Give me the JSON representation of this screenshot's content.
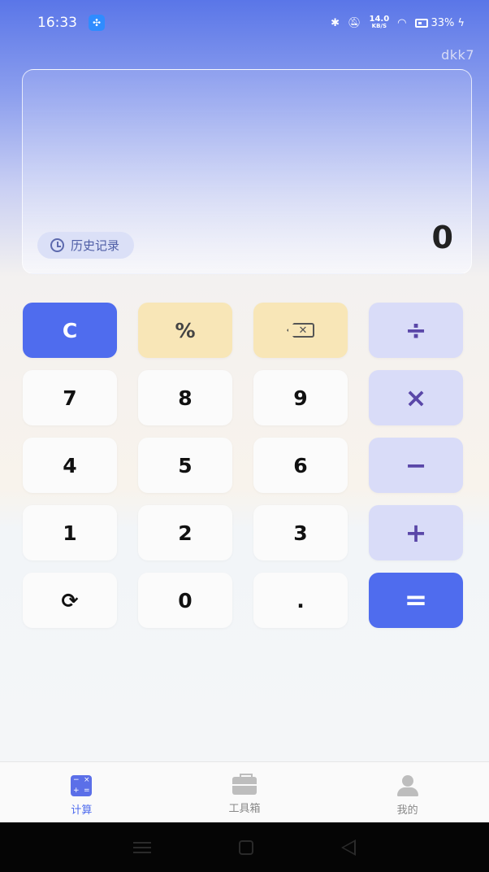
{
  "status_bar": {
    "time": "16:33",
    "net_speed": "14.0",
    "net_unit": "KB/S",
    "battery": "33%"
  },
  "username": "dkk7",
  "display": {
    "history_label": "历史记录",
    "result": "0"
  },
  "keys": [
    {
      "label": "C",
      "style": "blue",
      "name": "clear-button"
    },
    {
      "label": "%",
      "style": "yellow",
      "name": "percent-button"
    },
    {
      "label": "",
      "style": "yellow",
      "name": "backspace-button"
    },
    {
      "label": "÷",
      "style": "op",
      "name": "divide-button"
    },
    {
      "label": "7",
      "style": "num",
      "name": "digit-7-button"
    },
    {
      "label": "8",
      "style": "num",
      "name": "digit-8-button"
    },
    {
      "label": "9",
      "style": "num",
      "name": "digit-9-button"
    },
    {
      "label": "×",
      "style": "op",
      "name": "multiply-button"
    },
    {
      "label": "4",
      "style": "num",
      "name": "digit-4-button"
    },
    {
      "label": "5",
      "style": "num",
      "name": "digit-5-button"
    },
    {
      "label": "6",
      "style": "num",
      "name": "digit-6-button"
    },
    {
      "label": "−",
      "style": "op",
      "name": "subtract-button"
    },
    {
      "label": "1",
      "style": "num",
      "name": "digit-1-button"
    },
    {
      "label": "2",
      "style": "num",
      "name": "digit-2-button"
    },
    {
      "label": "3",
      "style": "num",
      "name": "digit-3-button"
    },
    {
      "label": "+",
      "style": "op",
      "name": "add-button"
    },
    {
      "label": "⟳",
      "style": "num",
      "name": "refresh-button"
    },
    {
      "label": "0",
      "style": "num",
      "name": "digit-0-button"
    },
    {
      "label": ".",
      "style": "num",
      "name": "decimal-button"
    },
    {
      "label": "=",
      "style": "equal",
      "name": "equals-button"
    }
  ],
  "bottom_nav": [
    {
      "label": "计算",
      "icon": "calculator-icon",
      "active": true
    },
    {
      "label": "工具箱",
      "icon": "toolbox-icon",
      "active": false
    },
    {
      "label": "我的",
      "icon": "user-icon",
      "active": false
    }
  ],
  "colors": {
    "accent": "#4f6cee",
    "operator_bg": "#d9dcf8",
    "function_bg": "#f8e6b7"
  }
}
